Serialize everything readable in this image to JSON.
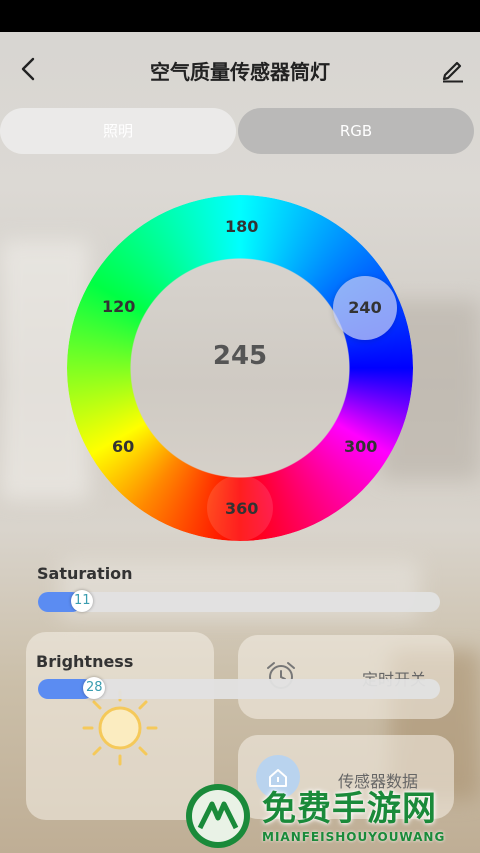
{
  "header": {
    "title": "空气质量传感器筒灯"
  },
  "tabs": [
    {
      "label": "照明"
    },
    {
      "label": "RGB"
    }
  ],
  "color_wheel": {
    "value": "245",
    "ticks": [
      "180",
      "240",
      "120",
      "60",
      "300",
      "360"
    ]
  },
  "saturation": {
    "label": "Saturation",
    "value": "11",
    "fraction": 0.11
  },
  "brightness": {
    "label": "Brightness",
    "value": "28",
    "fraction": 0.14
  },
  "cards": {
    "timer": "定时开关",
    "sensor": "传感器数据"
  },
  "watermark": {
    "title": "免费手游网",
    "sub": "MIANFEISHOUYOUWANG"
  },
  "colors": {
    "accent": "#5b8cf2",
    "brand_green": "#1a8a3a"
  }
}
